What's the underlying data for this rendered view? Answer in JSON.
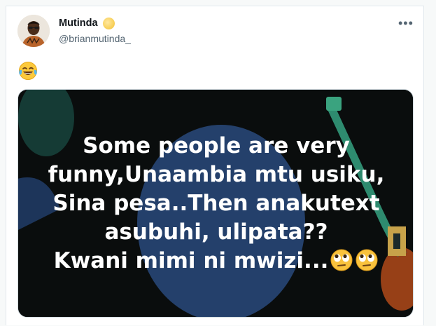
{
  "tweet": {
    "author_name": "Mutinda",
    "handle": "@brianmutinda_",
    "more_label": "•••",
    "text_emoji": "😂",
    "avatar_icon": "person-avatar",
    "verified_icon": "gold-badge-icon"
  },
  "media": {
    "lines": [
      "Some people are very",
      "funny,Unaambia mtu usiku,",
      "Sina pesa..Then anakutext",
      "asubuhi, ulipata??",
      "Kwani mimi ni mwizi..."
    ],
    "trailing_emoji": "face-with-rolling-eyes-icon",
    "colors": {
      "background": "#0a0d0d",
      "blob": "#24406b",
      "accent_green": "#2e8b6f",
      "text": "#ffffff"
    }
  }
}
